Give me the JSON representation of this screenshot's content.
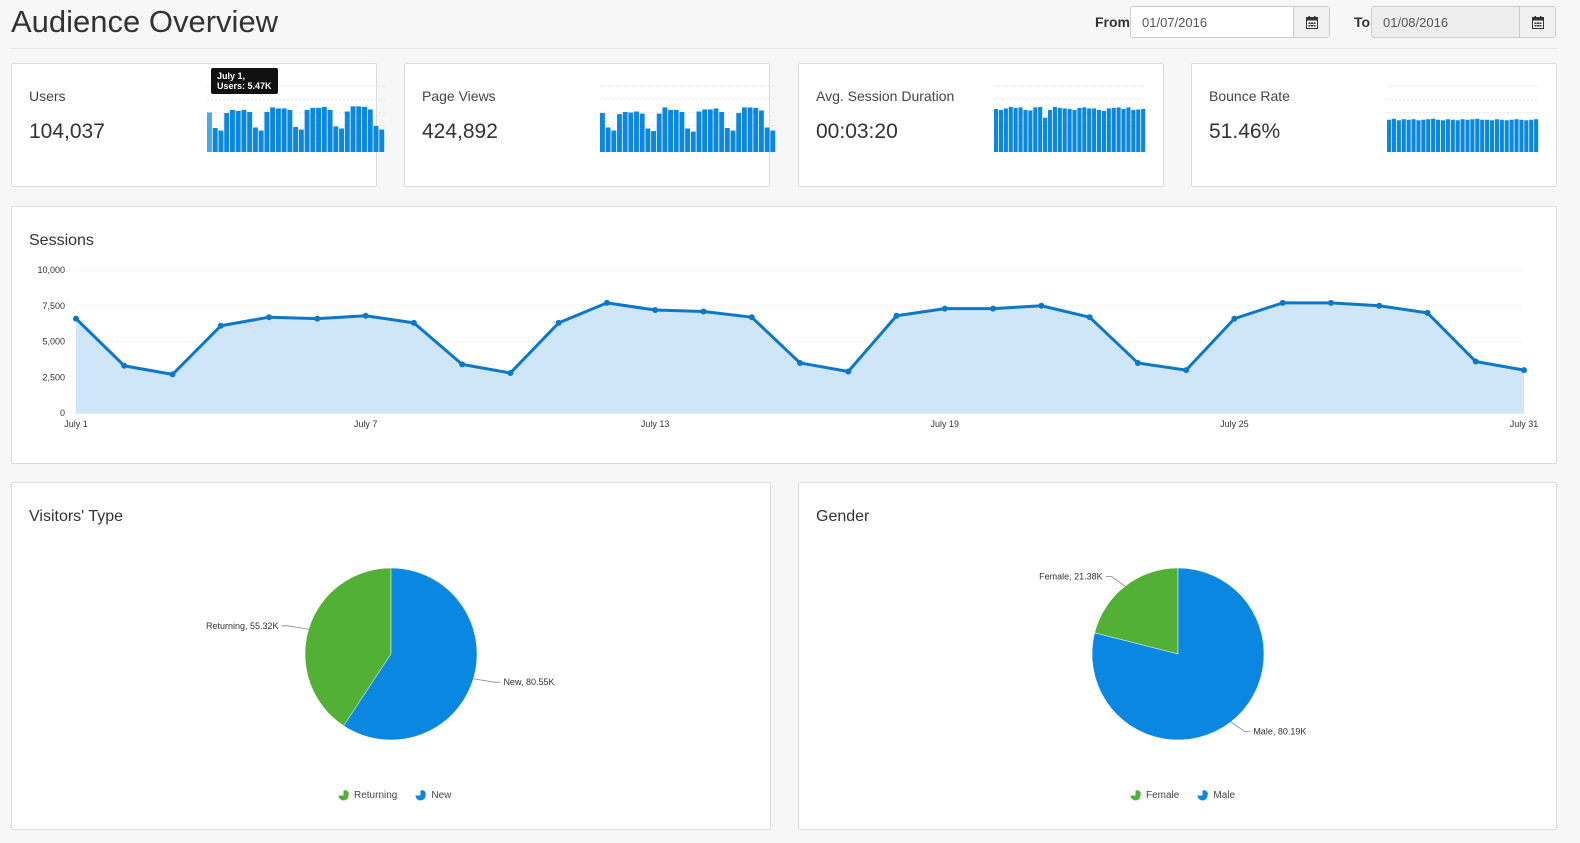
{
  "page": {
    "title": "Audience Overview"
  },
  "date_range": {
    "from_label": "From",
    "from_value": "01/07/2016",
    "to_label": "To",
    "to_value": "01/08/2016"
  },
  "kpis": [
    {
      "label": "Users",
      "value": "104,037",
      "spark": [
        6.5,
        3.5,
        3.0,
        6.4,
        7.0,
        6.8,
        7.0,
        6.6,
        3.6,
        3.0,
        6.6,
        7.5,
        7.3,
        7.3,
        7.0,
        3.7,
        3.2,
        7.0,
        7.4,
        7.4,
        7.6,
        7.0,
        3.8,
        3.4,
        6.7,
        7.7,
        7.7,
        7.6,
        7.1,
        3.9,
        3.2
      ]
    },
    {
      "label": "Page Views",
      "value": "424,892",
      "spark": [
        6.4,
        3.6,
        3.0,
        6.2,
        6.6,
        6.5,
        6.7,
        6.3,
        3.4,
        2.9,
        6.3,
        7.5,
        7.0,
        7.0,
        6.6,
        3.4,
        2.8,
        6.7,
        7.1,
        7.1,
        7.3,
        6.6,
        3.5,
        3.0,
        6.4,
        7.5,
        7.5,
        7.4,
        6.9,
        3.6,
        3.0
      ]
    },
    {
      "label": "Avg. Session Duration",
      "value": "00:03:20",
      "spark": [
        7.2,
        7.0,
        7.3,
        7.6,
        7.4,
        7.5,
        7.0,
        6.9,
        7.5,
        7.6,
        5.5,
        7.0,
        7.6,
        7.4,
        7.3,
        7.2,
        7.0,
        7.4,
        7.5,
        7.3,
        7.3,
        7.0,
        6.8,
        7.3,
        7.4,
        7.5,
        7.2,
        7.5,
        7.0,
        7.1,
        7.2
      ]
    },
    {
      "label": "Bounce Rate",
      "value": "51.46%",
      "spark": [
        5.1,
        5.3,
        5.0,
        5.2,
        5.1,
        5.2,
        5.0,
        5.1,
        5.2,
        5.3,
        5.1,
        5.0,
        5.2,
        5.1,
        5.0,
        5.2,
        5.1,
        5.2,
        5.3,
        5.1,
        5.1,
        5.0,
        5.2,
        5.1,
        5.0,
        5.1,
        5.2,
        5.1,
        5.0,
        5.1,
        5.2
      ]
    }
  ],
  "tooltip": {
    "line1": "July 1,",
    "line2": "Users: 5.47K"
  },
  "sessions": {
    "title": "Sessions",
    "chart_data": {
      "type": "area",
      "title": "Sessions",
      "xlabel": "",
      "ylabel": "",
      "ylim": [
        0,
        10000
      ],
      "yticks": [
        "10,000",
        "7,500",
        "5,000",
        "2,500",
        "0"
      ],
      "xtick_labels": [
        "July 1",
        "July 7",
        "July 13",
        "July 19",
        "July 25",
        "July 31"
      ],
      "values": [
        6600,
        3300,
        2700,
        6100,
        6700,
        6600,
        6800,
        6300,
        3400,
        2800,
        6300,
        7700,
        7200,
        7100,
        6700,
        3500,
        2900,
        6800,
        7300,
        7300,
        7500,
        6700,
        3500,
        3000,
        6600,
        7700,
        7700,
        7500,
        7000,
        3600,
        3000
      ],
      "line_color": "#0b78c9",
      "fill_color": "#cfe6f9",
      "grid": true
    }
  },
  "visitors": {
    "title": "Visitors' Type",
    "chart_data": {
      "type": "pie",
      "title": "Visitors' Type",
      "labels": [
        "Returning, 55.32K",
        "New, 80.55K"
      ],
      "slices": [
        {
          "name": "Returning",
          "value": 55.32,
          "color": "#52b134"
        },
        {
          "name": "New",
          "value": 80.55,
          "color": "#0a87e0"
        }
      ],
      "legend": [
        "Returning",
        "New"
      ]
    }
  },
  "gender": {
    "title": "Gender",
    "chart_data": {
      "type": "pie",
      "title": "Gender",
      "labels": [
        "Female, 21.38K",
        "Male, 80.19K"
      ],
      "slices": [
        {
          "name": "Female",
          "value": 21.38,
          "color": "#52b134"
        },
        {
          "name": "Male",
          "value": 80.19,
          "color": "#0a87e0"
        }
      ],
      "legend": [
        "Female",
        "Male"
      ]
    }
  },
  "colors": {
    "bar": "#0a87e0",
    "bar_first": "#4aaae8",
    "green": "#52b134",
    "blue": "#0a87e0"
  }
}
